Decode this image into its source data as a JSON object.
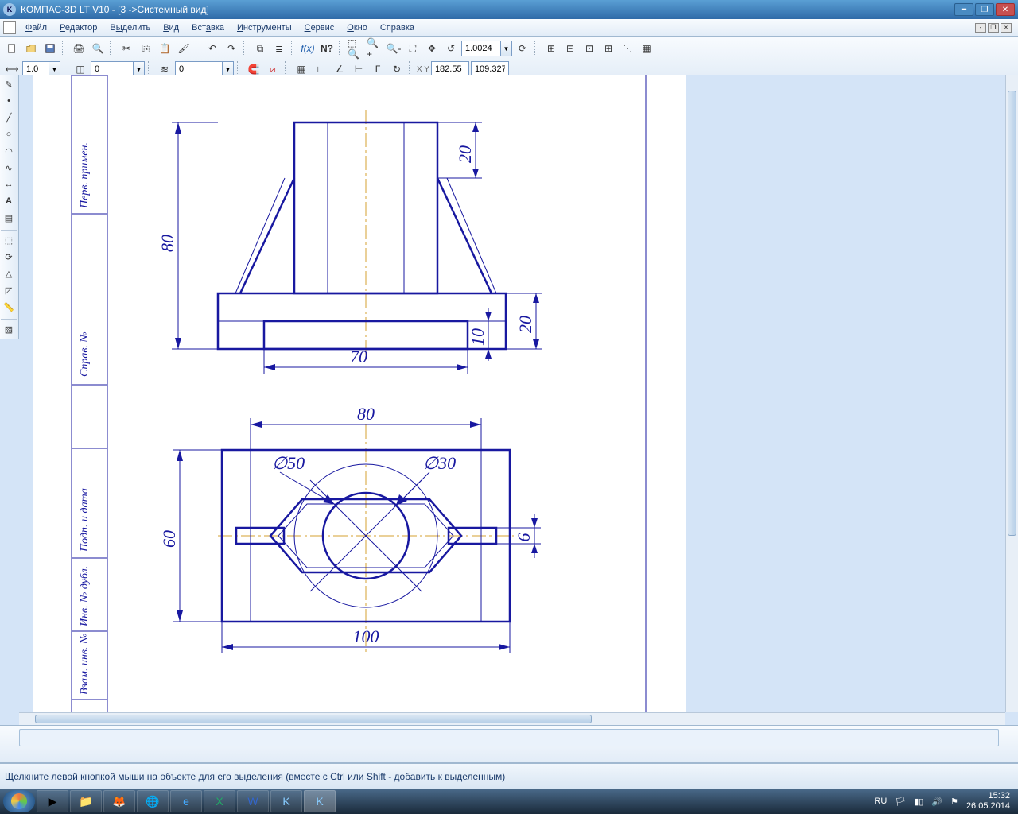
{
  "titlebar": {
    "title": "КОМПАС-3D LT V10 - [3  ->Системный вид]"
  },
  "menu": {
    "file": "Файл",
    "editor": "Редактор",
    "select": "Выделить",
    "view": "Вид",
    "insert": "Вставка",
    "tools": "Инструменты",
    "service": "Сервис",
    "window": "Окно",
    "help": "Справка"
  },
  "toolbar": {
    "zoom_combo": "1.0024",
    "scale_combo": "1.0",
    "layer_combo1": "0",
    "layer_combo2": "0",
    "coord_x": "182.55",
    "coord_y": "109.327"
  },
  "status": {
    "hint": "Щелкните левой кнопкой мыши на объекте для его выделения (вместе с Ctrl или Shift - добавить к выделенным)"
  },
  "tray": {
    "lang": "RU",
    "time": "15:32",
    "date": "26.05.2014"
  },
  "drawing": {
    "dims": {
      "d80_left": "80",
      "d20_tr": "20",
      "d70": "70",
      "d10": "10",
      "d20_r": "20",
      "d80_top": "80",
      "d50": "∅50",
      "d30": "∅30",
      "d60": "60",
      "d6": "6",
      "d100": "100"
    },
    "border_labels": {
      "perv": "Перв. примен.",
      "sprav": "Справ. №",
      "podp": "Подп. и дата",
      "inv": "Инв. № дубл.",
      "vzam": "Взам. инв. №"
    }
  }
}
